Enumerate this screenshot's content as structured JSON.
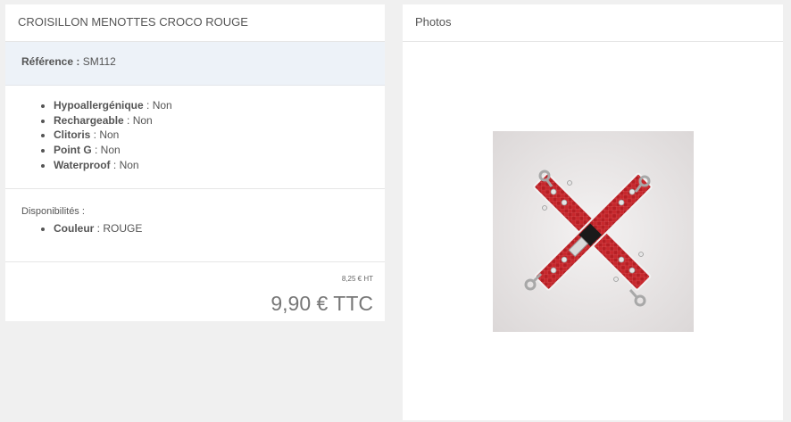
{
  "product": {
    "title": "CROISILLON MENOTTES CROCO ROUGE",
    "reference_label": "Référence :",
    "reference_value": "SM112",
    "features": [
      {
        "label": "Hypoallergénique",
        "value": " : Non"
      },
      {
        "label": "Rechargeable",
        "value": " : Non"
      },
      {
        "label": "Clitoris",
        "value": " : Non"
      },
      {
        "label": "Point G",
        "value": " : Non"
      },
      {
        "label": "Waterproof",
        "value": " : Non"
      }
    ],
    "availability_label": "Disponibilités :",
    "availability": [
      {
        "label": "Couleur",
        "value": " : ROUGE"
      }
    ],
    "price_ht": "8,25 € HT",
    "price_ttc": "9,90 € TTC"
  },
  "photos": {
    "title": "Photos"
  },
  "colors": {
    "background": "#f0f0f0",
    "panel": "#ffffff",
    "reference_bg": "#edf2f8",
    "strap_red": "#c8282d"
  }
}
